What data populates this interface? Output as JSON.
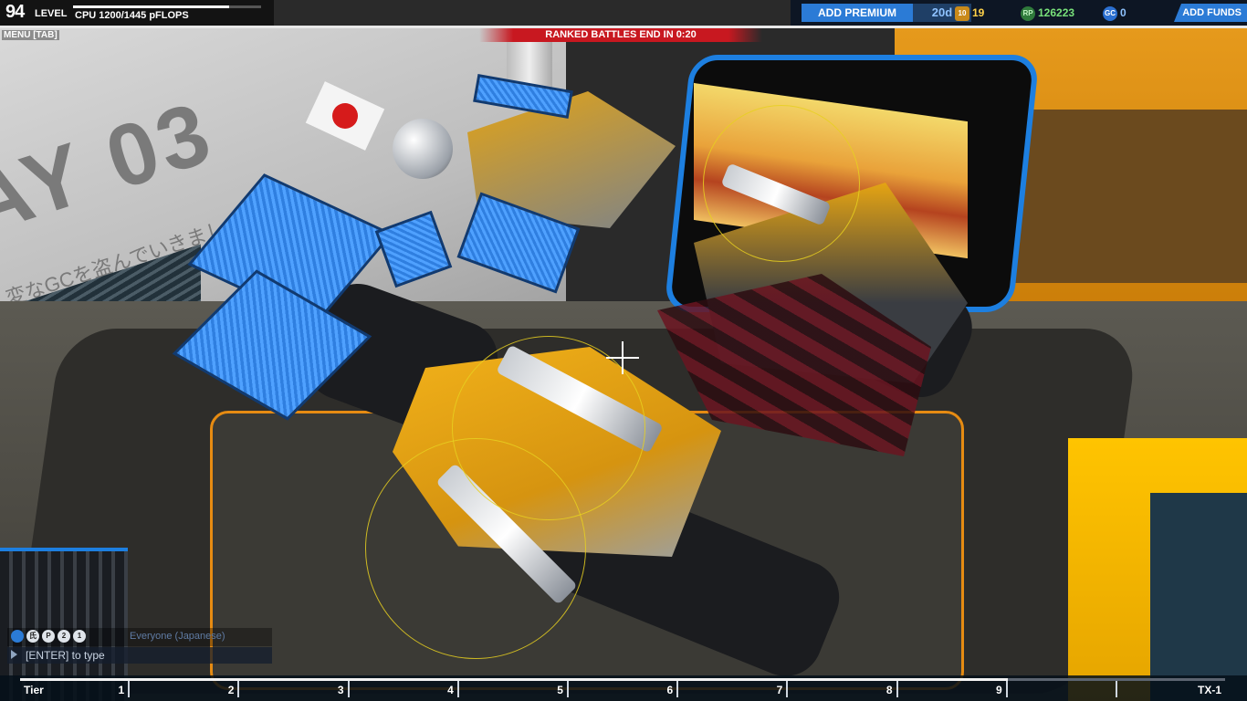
{
  "hud": {
    "level_number": "94",
    "level_label": "LEVEL",
    "cpu_text": "CPU 1200/1445 pFLOPS",
    "cpu_fraction": 0.83,
    "menu_label": "MENU [TAB]"
  },
  "banner": {
    "text": "RANKED BATTLES END IN 0:20"
  },
  "currency": {
    "add_premium_label": "ADD PREMIUM",
    "premium_days": "20d",
    "tier_icon": "tier-icon",
    "tier_icon_text": "10",
    "tier_value": "19",
    "rp_icon": "robit-points-icon",
    "rp_icon_text": "RP",
    "rp_value": "126223",
    "gc_icon": "galaxy-coins-icon",
    "gc_icon_text": "GC",
    "gc_value": "0",
    "add_funds_label": "ADD FUNDS"
  },
  "scene": {
    "bay_label": "AY 03",
    "bay_subtitle": "変なGCを盗んでいきました"
  },
  "chat": {
    "channel": "Everyone (Japanese)",
    "input_placeholder": "[ENTER] to type",
    "filter_icons": [
      "globe-icon",
      "clan-icon",
      "party-icon",
      "whisper-icon",
      "user-icon"
    ],
    "filter_icon_glyphs": [
      "",
      "氏",
      "P",
      "2",
      "1"
    ]
  },
  "tier_bar": {
    "label": "Tier",
    "progress_fraction": 0.82,
    "tiers": [
      "1",
      "2",
      "3",
      "4",
      "5",
      "6",
      "7",
      "8",
      "9",
      "",
      "TX-1"
    ]
  },
  "colors": {
    "accent_blue": "#2b7bd6",
    "banner_red": "#c81820",
    "rp_green": "#78e07a",
    "tier_gold": "#ffd24a"
  }
}
